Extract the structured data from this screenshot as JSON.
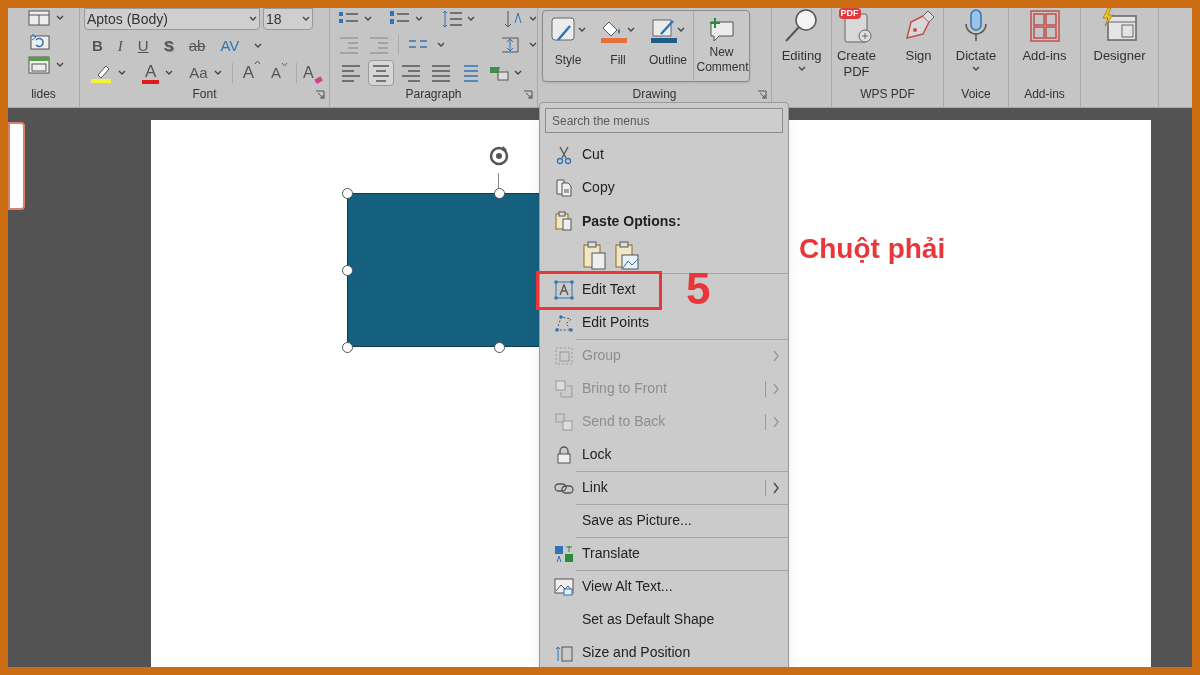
{
  "ribbon": {
    "groups": [
      {
        "kind": "slides",
        "label": "lides"
      },
      {
        "kind": "font",
        "label": "Font",
        "font_name": "Aptos (Body)",
        "font_size": "18",
        "format_buttons": [
          "B",
          "I",
          "U",
          "S",
          "ab",
          "AV"
        ],
        "color_button": "A",
        "case_button": "Aa",
        "grow_button": "A",
        "shrink_button": "A",
        "clear_button": "A"
      },
      {
        "kind": "paragraph",
        "label": "Paragraph",
        "align_buttons": [
          {
            "selected": false
          },
          {
            "selected": true
          },
          {
            "selected": false
          },
          {
            "selected": false
          },
          {
            "selected": false
          }
        ]
      },
      {
        "kind": "drawing",
        "label": "Drawing",
        "buttons": [
          {
            "label": "Style"
          },
          {
            "label": "Fill",
            "color": "#e8703a"
          },
          {
            "label": "Outline",
            "color": "#1c5e85"
          },
          {
            "label": "New Comment"
          }
        ]
      },
      {
        "kind": "buttons",
        "buttons": [
          {
            "label": "Editing",
            "dropdown": true
          }
        ]
      },
      {
        "kind": "buttons",
        "label": "WPS PDF",
        "buttons": [
          {
            "label": "Create PDF",
            "dropdown": false,
            "badge": "PDF"
          },
          {
            "label": "Sign",
            "dropdown": false
          }
        ]
      },
      {
        "kind": "buttons",
        "label": "Voice",
        "buttons": [
          {
            "label": "Dictate",
            "dropdown": true
          }
        ]
      },
      {
        "kind": "buttons",
        "label": "Add-ins",
        "buttons": [
          {
            "label": "Add-ins",
            "dropdown": false
          }
        ]
      },
      {
        "kind": "buttons",
        "buttons": [
          {
            "label": "Designer",
            "dropdown": false
          }
        ]
      }
    ]
  },
  "context_menu": {
    "search": {
      "placeholder": "Search the menus"
    },
    "items": [
      {
        "kind": "item",
        "label": "Cut",
        "separator_before": false,
        "disabled": false,
        "submenu": false,
        "split": false,
        "highlighted": false
      },
      {
        "kind": "item",
        "label": "Copy",
        "separator_before": false,
        "disabled": false,
        "submenu": false,
        "split": false,
        "highlighted": false
      },
      {
        "kind": "header",
        "label": "Paste Options:"
      },
      {
        "kind": "paste_buttons"
      },
      {
        "kind": "item",
        "label": "Edit Text",
        "separator_before": true,
        "disabled": false,
        "submenu": false,
        "split": false,
        "highlighted": true
      },
      {
        "kind": "item",
        "label": "Edit Points",
        "separator_before": false,
        "disabled": false,
        "submenu": false,
        "split": false,
        "highlighted": false
      },
      {
        "kind": "item",
        "label": "Group",
        "separator_before": true,
        "disabled": true,
        "submenu": true,
        "split": false,
        "highlighted": false
      },
      {
        "kind": "item",
        "label": "Bring to Front",
        "separator_before": false,
        "disabled": true,
        "submenu": true,
        "split": true,
        "highlighted": false
      },
      {
        "kind": "item",
        "label": "Send to Back",
        "separator_before": false,
        "disabled": true,
        "submenu": true,
        "split": true,
        "highlighted": false
      },
      {
        "kind": "item",
        "label": "Lock",
        "separator_before": false,
        "disabled": false,
        "submenu": false,
        "split": false,
        "highlighted": false
      },
      {
        "kind": "item",
        "label": "Link",
        "separator_before": true,
        "disabled": false,
        "submenu": true,
        "split": true,
        "highlighted": false
      },
      {
        "kind": "item",
        "label": "Save as Picture...",
        "separator_before": true,
        "disabled": false,
        "submenu": false,
        "split": false,
        "highlighted": false
      },
      {
        "kind": "item",
        "label": "Translate",
        "separator_before": true,
        "disabled": false,
        "submenu": false,
        "split": false,
        "highlighted": false
      },
      {
        "kind": "item",
        "label": "View Alt Text...",
        "separator_before": true,
        "disabled": false,
        "submenu": false,
        "split": false,
        "highlighted": false
      },
      {
        "kind": "item",
        "label": "Set as Default Shape",
        "separator_before": false,
        "disabled": false,
        "submenu": false,
        "split": false,
        "highlighted": false
      },
      {
        "kind": "item",
        "label": "Size and Position",
        "separator_before": false,
        "disabled": false,
        "submenu": false,
        "split": false,
        "highlighted": false
      }
    ]
  },
  "annotations": {
    "label": "Chuột phải",
    "step": "5"
  }
}
